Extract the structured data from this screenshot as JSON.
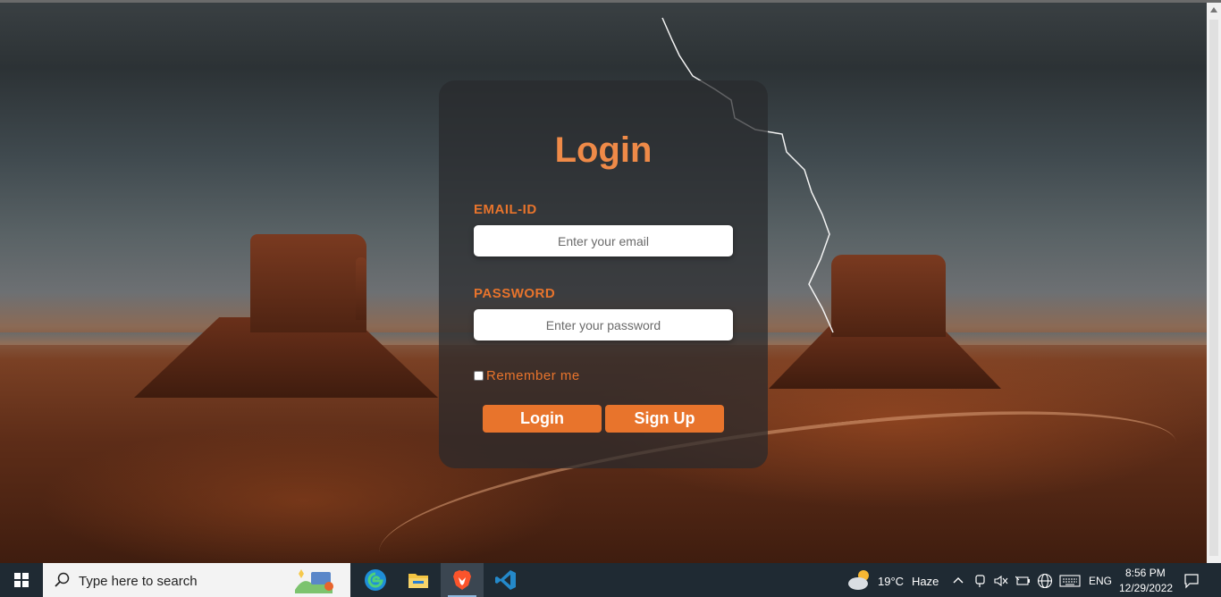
{
  "login": {
    "title": "Login",
    "email_label": "EMAIL-ID",
    "email_placeholder": "Enter your email",
    "password_label": "PASSWORD",
    "password_placeholder": "Enter your password",
    "remember_label": "Remember me",
    "login_button": "Login",
    "signup_button": "Sign Up"
  },
  "colors": {
    "accent": "#e8742c",
    "title": "#ef8a48",
    "card_bg": "rgba(40,42,44,0.72)",
    "taskbar_bg": "#1f2a33"
  },
  "taskbar": {
    "search_placeholder": "Type here to search",
    "apps": [
      "edge-icon",
      "file-explorer-icon",
      "brave-browser-icon",
      "vscode-icon"
    ],
    "weather_temp": "19°C",
    "weather_condition": "Haze",
    "language": "ENG",
    "time": "8:56 PM",
    "date": "12/29/2022"
  }
}
